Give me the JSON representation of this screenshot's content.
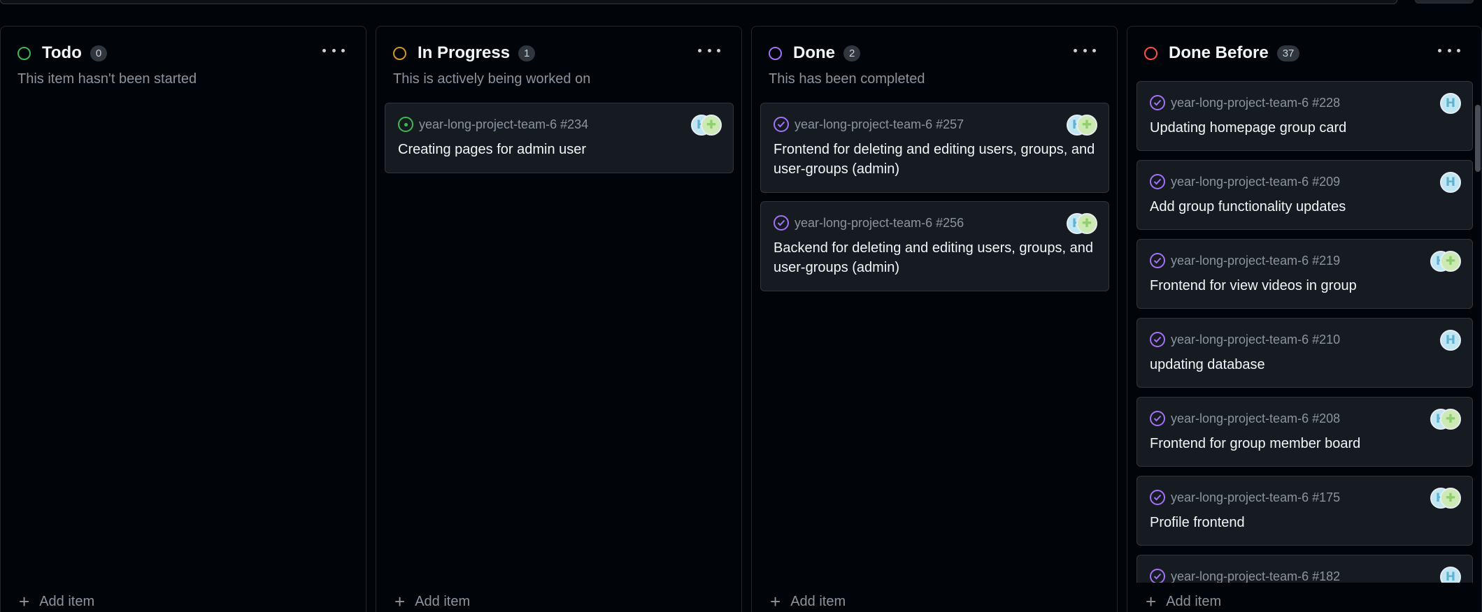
{
  "columns": [
    {
      "title": "Todo",
      "count": "0",
      "description": "This item hasn't been started",
      "status_color": "#3fb950",
      "add_label": "Add item",
      "cards": []
    },
    {
      "title": "In Progress",
      "count": "1",
      "description": "This is actively being worked on",
      "status_color": "#d29922",
      "add_label": "Add item",
      "cards": [
        {
          "ref": "year-long-project-team-6 #234",
          "title": "Creating pages for admin user",
          "icon": "open-issue-icon"
        }
      ]
    },
    {
      "title": "Done",
      "count": "2",
      "description": "This has been completed",
      "status_color": "#a371f7",
      "add_label": "Add item",
      "cards": [
        {
          "ref": "year-long-project-team-6 #257",
          "title": "Frontend for deleting and editing users, groups, and user-groups (admin)",
          "icon": "closed-issue-icon"
        },
        {
          "ref": "year-long-project-team-6 #256",
          "title": "Backend for deleting and editing users, groups, and user-groups (admin)",
          "icon": "closed-issue-icon"
        }
      ]
    },
    {
      "title": "Done Before",
      "count": "37",
      "description": "",
      "status_color": "#f85149",
      "add_label": "Add item",
      "cards": [
        {
          "ref": "year-long-project-team-6 #228",
          "title": "Updating homepage group card",
          "icon": "closed-issue-icon"
        },
        {
          "ref": "year-long-project-team-6 #209",
          "title": "Add group functionality updates",
          "icon": "closed-issue-icon"
        },
        {
          "ref": "year-long-project-team-6 #219",
          "title": "Frontend for view videos in group",
          "icon": "closed-issue-icon"
        },
        {
          "ref": "year-long-project-team-6 #210",
          "title": "updating database",
          "icon": "closed-issue-icon"
        },
        {
          "ref": "year-long-project-team-6 #208",
          "title": "Frontend for group member board",
          "icon": "closed-issue-icon"
        },
        {
          "ref": "year-long-project-team-6 #175",
          "title": "Profile frontend",
          "icon": "closed-issue-icon"
        },
        {
          "ref": "year-long-project-team-6 #182",
          "title": "",
          "icon": "closed-issue-icon"
        }
      ]
    }
  ],
  "colors": {
    "open_issue": "#3fb950",
    "closed_issue": "#a371f7",
    "background": "#010409",
    "card": "#161b22"
  }
}
